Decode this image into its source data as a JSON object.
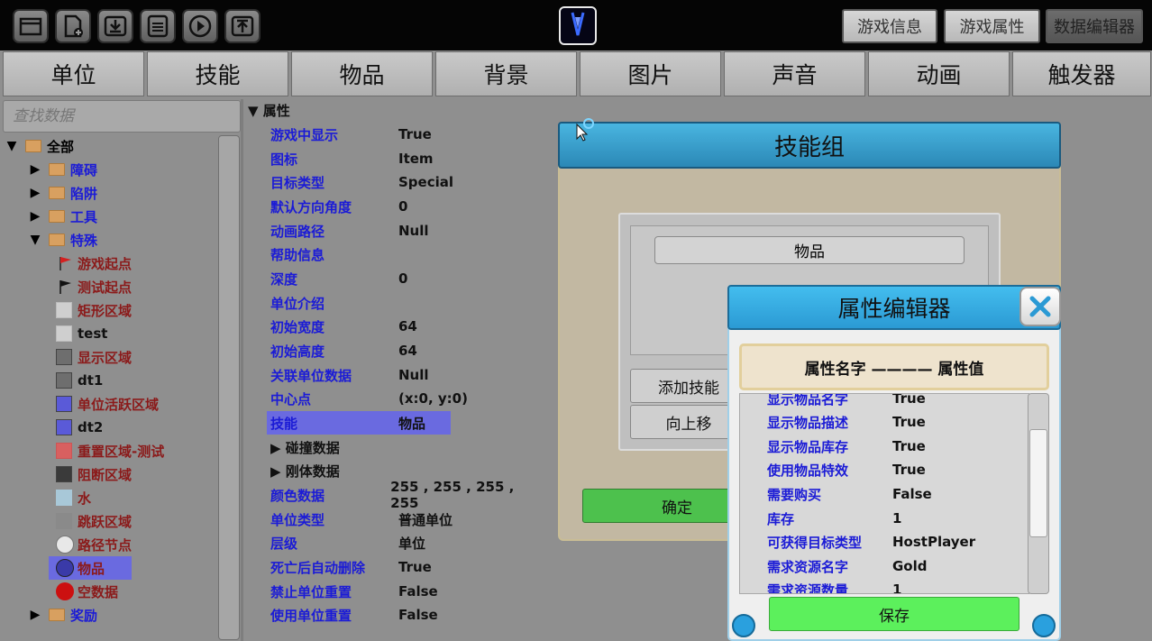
{
  "toolbar": {
    "buttons": [
      "folder-open-icon",
      "new-file-icon",
      "download-icon",
      "save-icon",
      "play-icon",
      "upload-icon"
    ],
    "game_info": "游戏信息",
    "game_props": "游戏属性",
    "data_editor": "数据编辑器"
  },
  "tabs": [
    "单位",
    "技能",
    "物品",
    "背景",
    "图片",
    "声音",
    "动画",
    "触发器"
  ],
  "search": {
    "placeholder": "查找数据"
  },
  "tree": {
    "root": "全部",
    "folders": [
      "障碍",
      "陷阱",
      "工具",
      "特殊"
    ],
    "special_items": [
      {
        "label": "游戏起点",
        "icon": "red-flag",
        "color": "#8b1a1a"
      },
      {
        "label": "测试起点",
        "icon": "black-flag",
        "color": "#8b1a1a"
      },
      {
        "label": "矩形区域",
        "icon": "swatch",
        "swatch": "#cfcfcf",
        "color": "#8b1a1a"
      },
      {
        "label": "test",
        "icon": "swatch",
        "swatch": "#cfcfcf",
        "color": "#111111"
      },
      {
        "label": "显示区域",
        "icon": "swatch",
        "swatch": "#6e6e6e",
        "color": "#8b1a1a"
      },
      {
        "label": "dt1",
        "icon": "swatch",
        "swatch": "#6e6e6e",
        "color": "#111111"
      },
      {
        "label": "单位活跃区域",
        "icon": "swatch",
        "swatch": "#5a5ad8",
        "color": "#8b1a1a"
      },
      {
        "label": "dt2",
        "icon": "swatch",
        "swatch": "#5a5ad8",
        "color": "#111111"
      },
      {
        "label": "重置区域-测试",
        "icon": "swatch",
        "swatch": "#d86060",
        "color": "#8b1a1a"
      },
      {
        "label": "阻断区域",
        "icon": "swatch",
        "swatch": "#3a3a3a",
        "color": "#8b1a1a"
      },
      {
        "label": "水",
        "icon": "swatch",
        "swatch": "#a8c8d8",
        "color": "#8b1a1a"
      },
      {
        "label": "跳跃区域",
        "icon": "swatch",
        "swatch": "#8a8a8a",
        "color": "#8b1a1a"
      },
      {
        "label": "路径节点",
        "icon": "path-dot",
        "color": "#8b1a1a"
      },
      {
        "label": "物品",
        "icon": "item-dot",
        "color": "#8b1a1a",
        "selected": true
      },
      {
        "label": "空数据",
        "icon": "null-dot",
        "color": "#8b1a1a"
      }
    ],
    "last_folder": "奖励"
  },
  "properties": {
    "section": "▼ 属性",
    "rows": [
      {
        "key": "游戏中显示",
        "value": "True"
      },
      {
        "key": "图标",
        "value": "Item"
      },
      {
        "key": "目标类型",
        "value": "Special"
      },
      {
        "key": "默认方向角度",
        "value": "0"
      },
      {
        "key": "动画路径",
        "value": "Null"
      },
      {
        "key": "帮助信息",
        "value": ""
      },
      {
        "key": "深度",
        "value": "0"
      },
      {
        "key": "单位介绍",
        "value": ""
      },
      {
        "key": "初始宽度",
        "value": "64"
      },
      {
        "key": "初始高度",
        "value": "64"
      },
      {
        "key": "关联单位数据",
        "value": "Null"
      },
      {
        "key": "中心点",
        "value": "(x:0, y:0)"
      },
      {
        "key": "技能",
        "value": "物品",
        "selected": true
      },
      {
        "key": "▶ 碰撞数据",
        "value": "",
        "group": true
      },
      {
        "key": "▶ 刚体数据",
        "value": "",
        "group": true
      },
      {
        "key": "颜色数据",
        "value": "255 , 255 , 255 , 255"
      },
      {
        "key": "单位类型",
        "value": "普通单位"
      },
      {
        "key": "层级",
        "value": "单位"
      },
      {
        "key": "死亡后自动删除",
        "value": "True"
      },
      {
        "key": "禁止单位重置",
        "value": "False"
      },
      {
        "key": "使用单位重置",
        "value": "False"
      }
    ]
  },
  "skill_group": {
    "title": "技能组",
    "item": "物品",
    "add_skill": "添加技能",
    "move_up": "向上移",
    "ok": "确定"
  },
  "prop_editor": {
    "title": "属性编辑器",
    "column_header": "属性名字 ———— 属性值",
    "rows": [
      {
        "key": "显示物品名字",
        "value": "True"
      },
      {
        "key": "显示物品描述",
        "value": "True"
      },
      {
        "key": "显示物品库存",
        "value": "True"
      },
      {
        "key": "使用物品特效",
        "value": "True"
      },
      {
        "key": "需要购买",
        "value": "False"
      },
      {
        "key": "库存",
        "value": "1"
      },
      {
        "key": "可获得目标类型",
        "value": "HostPlayer"
      },
      {
        "key": "需求资源名字",
        "value": "Gold"
      },
      {
        "key": "需求资源数量",
        "value": "1"
      }
    ],
    "save": "保存"
  },
  "colors": {
    "key_blue": "#1b1bd6",
    "selected_bg": "#6a6ae0",
    "dialog_header": "#2b9ad4",
    "save_green": "#5cf05c",
    "ok_green": "#4dc14d"
  }
}
